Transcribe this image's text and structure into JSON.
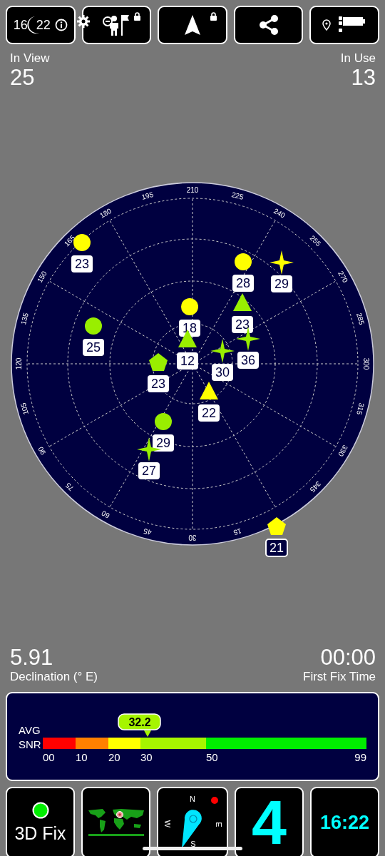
{
  "toolbar": [
    {
      "kind": "clock",
      "texts": [
        "16",
        "22"
      ],
      "locked": false
    },
    {
      "kind": "target",
      "locked": true
    },
    {
      "kind": "navigate",
      "locked": true
    },
    {
      "kind": "share",
      "locked": false
    },
    {
      "kind": "location",
      "locked": false
    }
  ],
  "stats": {
    "in_view": {
      "label": "In View",
      "value": "25"
    },
    "in_use": {
      "label": "In Use",
      "value": "13"
    }
  },
  "sky_plot": {
    "azimuth_labels": [
      "210",
      "225",
      "240",
      "255",
      "270",
      "285",
      "300",
      "315",
      "330",
      "345",
      "15",
      "30",
      "45",
      "60",
      "75",
      "90",
      "105",
      "120",
      "135",
      "150",
      "165",
      "180",
      "195"
    ],
    "satellites": [
      {
        "kind": "circle",
        "color": "#ffff00",
        "label": "23",
        "in_use": true
      },
      {
        "kind": "circle",
        "color": "#ffff00",
        "label": "28",
        "in_use": true
      },
      {
        "kind": "star",
        "color": "#ffff00",
        "label": "29",
        "in_use": true
      },
      {
        "kind": "circle",
        "color": "#ffff00",
        "label": "18",
        "in_use": true
      },
      {
        "kind": "triangle",
        "color": "#99ee00",
        "label": "23",
        "in_use": true
      },
      {
        "kind": "circle",
        "color": "#99ee00",
        "label": "25",
        "in_use": true
      },
      {
        "kind": "triangle",
        "color": "#99ee00",
        "label": "12",
        "in_use": true
      },
      {
        "kind": "star",
        "color": "#99ee00",
        "label": "36",
        "in_use": true
      },
      {
        "kind": "star",
        "color": "#99ee00",
        "label": "30",
        "in_use": true
      },
      {
        "kind": "pentagon",
        "color": "#99ee00",
        "label": "23",
        "in_use": true
      },
      {
        "kind": "triangle",
        "color": "#ffff00",
        "label": "22",
        "in_use": true
      },
      {
        "kind": "circle",
        "color": "#99ee00",
        "label": "29",
        "in_use": true
      },
      {
        "kind": "star",
        "color": "#99ee00",
        "label": "27",
        "in_use": true
      },
      {
        "kind": "pentagon",
        "color": "#ffff00",
        "label": "21",
        "in_use": false
      }
    ]
  },
  "declination": {
    "value": "5.91",
    "label": "Declination (° E)"
  },
  "first_fix": {
    "value": "00:00",
    "label": "First Fix Time"
  },
  "snr": {
    "labels": [
      "AVG",
      "SNR"
    ],
    "value": "32.2",
    "level": 0.324,
    "segments": [
      {
        "color": "#ff0000"
      },
      {
        "color": "#ff8000"
      },
      {
        "color": "#ffff00"
      },
      {
        "color": "#a6f500"
      },
      {
        "color": "#00ee00"
      }
    ],
    "scale_labels": [
      "00",
      "10",
      "20",
      "30",
      "50",
      "99"
    ]
  },
  "tiles": {
    "fix_label": "3D Fix",
    "compass_letters": [
      "N",
      "E",
      "S",
      "W"
    ],
    "satellite_count": "4",
    "clock": "16:22"
  }
}
